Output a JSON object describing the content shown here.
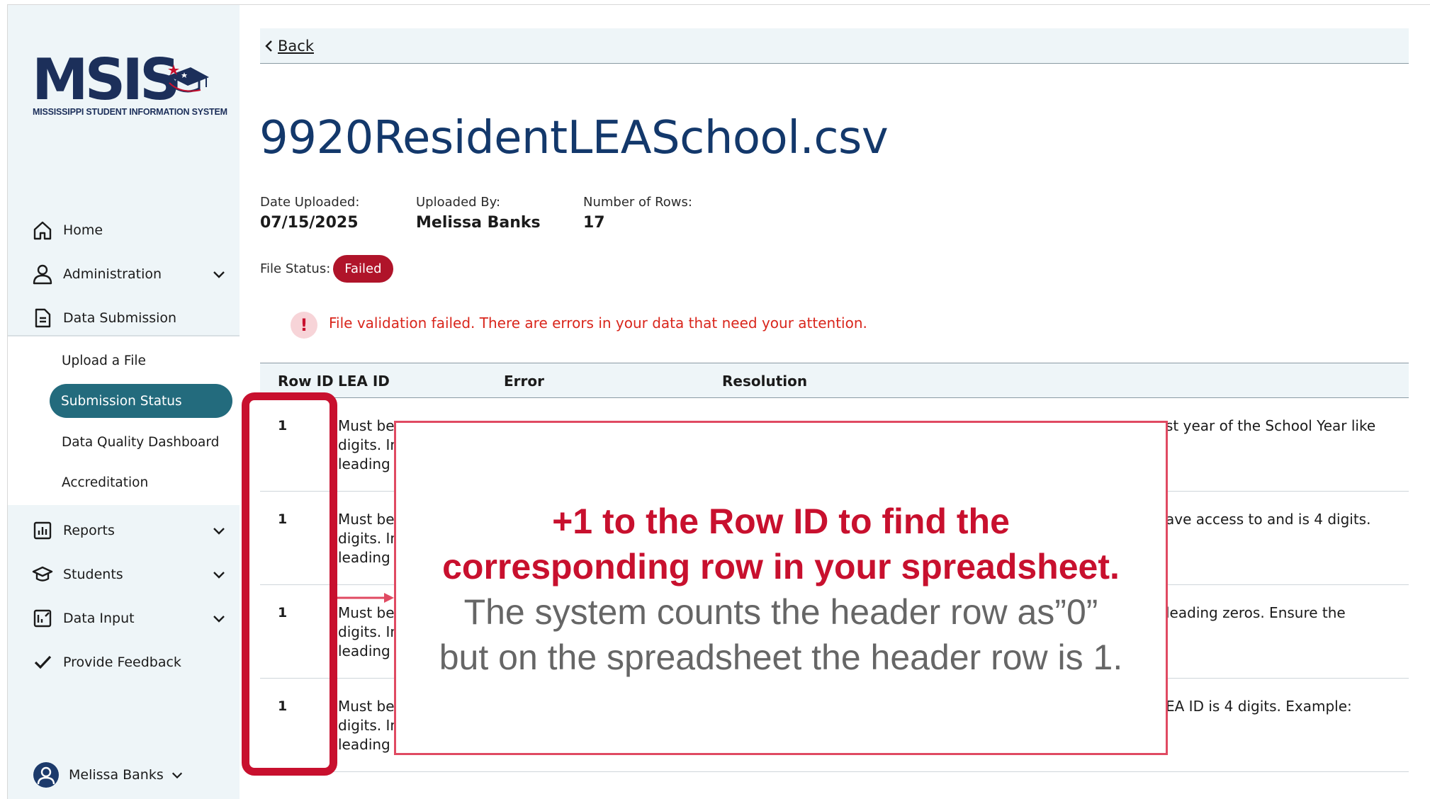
{
  "brand": {
    "wordmark": "MSIS",
    "tagline": "MISSISSIPPI STUDENT INFORMATION SYSTEM"
  },
  "sidebar": {
    "items": [
      {
        "label": "Home",
        "icon": "home-icon"
      },
      {
        "label": "Administration",
        "icon": "person-icon"
      },
      {
        "label": "Data Submission",
        "icon": "document-icon"
      },
      {
        "label": "Reports",
        "icon": "bar-chart-icon"
      },
      {
        "label": "Students",
        "icon": "graduation-cap-icon"
      },
      {
        "label": "Data Input",
        "icon": "form-icon"
      },
      {
        "label": "Provide Feedback",
        "icon": "checkmark-icon"
      }
    ],
    "sub_items": [
      {
        "label": "Upload a File"
      },
      {
        "label": "Submission Status",
        "active": true
      },
      {
        "label": "Data Quality Dashboard"
      },
      {
        "label": "Accreditation"
      }
    ],
    "user": {
      "name": "Melissa Banks"
    }
  },
  "main": {
    "back_label": "Back",
    "title": "9920ResidentLEASchool.csv",
    "meta": {
      "date_label": "Date Uploaded:",
      "date_value": "07/15/2025",
      "by_label": "Uploaded By:",
      "by_value": "Melissa Banks",
      "rows_label": "Number of Rows:",
      "rows_value": "17"
    },
    "status_label": "File Status:",
    "status_value": "Failed",
    "alert_text": "File validation failed. There are errors in your data that need your attention.",
    "table": {
      "headers": [
        "Row ID",
        "LEA ID",
        "Error",
        "Resolution"
      ],
      "rows": [
        {
          "row_id": "1",
          "left": [
            "Must be",
            "digits. In",
            "leading"
          ],
          "right": "st year of the School Year like"
        },
        {
          "row_id": "1",
          "left": [
            "Must be",
            "digits. In",
            "leading"
          ],
          "right": "ave access to and is 4 digits."
        },
        {
          "row_id": "1",
          "left": [
            "Must be",
            "digits. In",
            "leading"
          ],
          "right": "leading zeros. Ensure the"
        },
        {
          "row_id": "1",
          "left": [
            "Must be",
            "digits. In",
            "leading"
          ],
          "right": "EA ID is 4 digits. Example:"
        }
      ]
    }
  },
  "callout": {
    "line1": "+1 to the Row ID to find the",
    "line2": "corresponding row in your spreadsheet.",
    "line3": "The system counts the header row as”0”",
    "line4": "but on the spreadsheet the header row is 1."
  },
  "colors": {
    "navy": "#13386b",
    "accent_red": "#c8102e",
    "active_teal": "#236b7d",
    "sidebar_bg": "#eef5f8"
  }
}
